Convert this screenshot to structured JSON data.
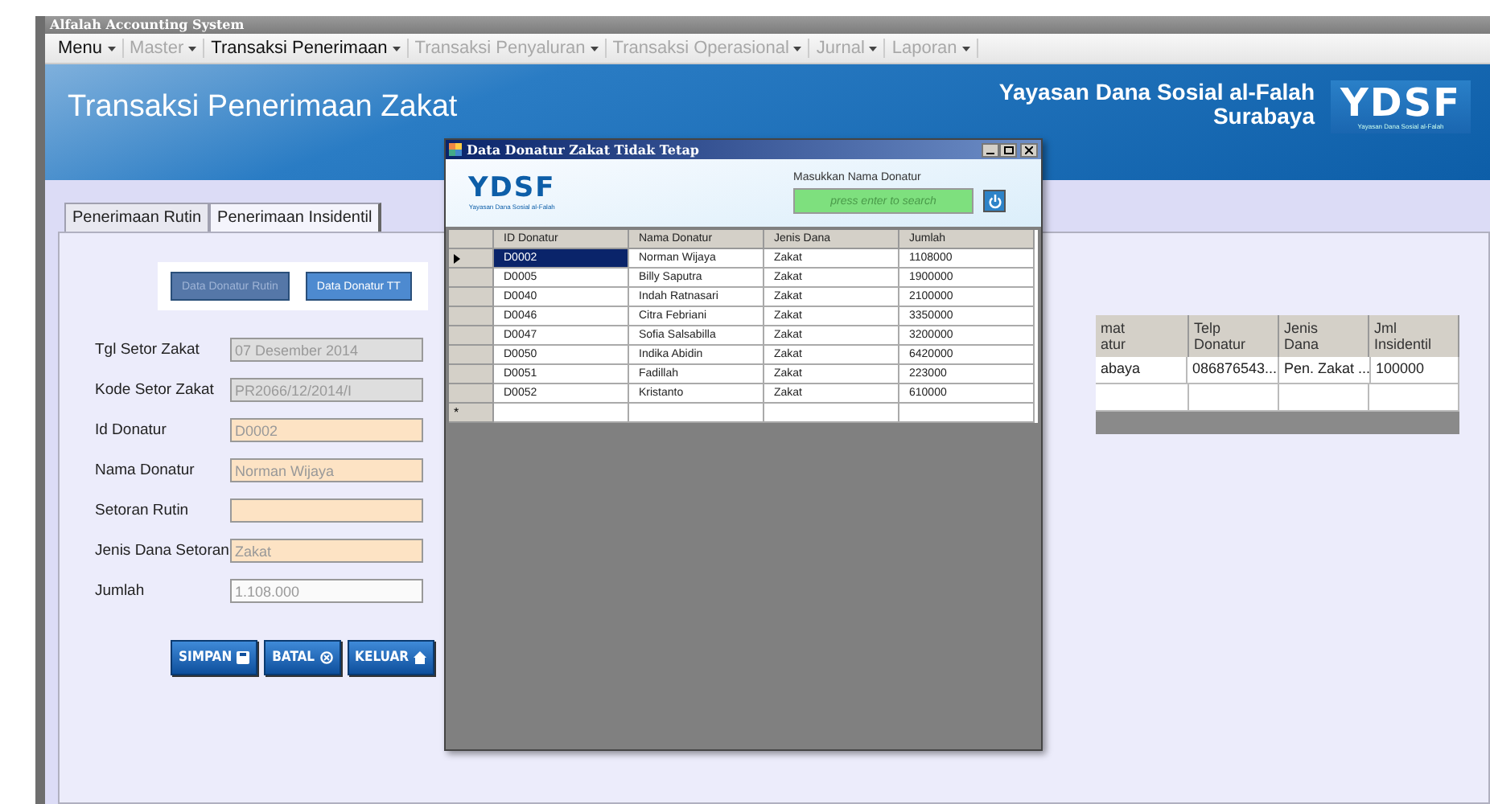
{
  "app_title": "Alfalah Accounting System",
  "menu": [
    {
      "label": "Menu",
      "disabled": false
    },
    {
      "label": "Master",
      "disabled": true
    },
    {
      "label": "Transaksi Penerimaan",
      "disabled": false
    },
    {
      "label": "Transaksi Penyaluran",
      "disabled": true
    },
    {
      "label": "Transaksi Operasional",
      "disabled": true
    },
    {
      "label": "Jurnal",
      "disabled": true
    },
    {
      "label": "Laporan",
      "disabled": true
    }
  ],
  "header": {
    "title": "Transaksi Penerimaan Zakat",
    "org_name": "Yayasan Dana Sosial al-Falah",
    "org_city": "Surabaya",
    "logo_text": "YDSF",
    "logo_tagline": "Yayasan Dana Sosial al-Falah"
  },
  "tabs": [
    {
      "label": "Penerimaan Rutin",
      "selected": false
    },
    {
      "label": "Penerimaan Insidentil",
      "selected": true
    }
  ],
  "source_buttons": [
    {
      "label": "Data Donatur Rutin",
      "disabled": true
    },
    {
      "label": "Data Donatur TT",
      "disabled": false
    }
  ],
  "form": [
    {
      "label": "Tgl Setor Zakat",
      "value": "07 Desember 2014",
      "kind": "readonly"
    },
    {
      "label": "Kode Setor Zakat",
      "value": "PR2066/12/2014/I",
      "kind": "readonly"
    },
    {
      "label": "Id Donatur",
      "value": "D0002",
      "kind": "filled"
    },
    {
      "label": "Nama Donatur",
      "value": "Norman Wijaya",
      "kind": "filled"
    },
    {
      "label": "Setoran Rutin",
      "kind": "filled"
    },
    {
      "label": "Jenis Dana Setoran",
      "value": "Zakat",
      "kind": "filled"
    },
    {
      "label": "Jumlah",
      "value": "1.108.000",
      "kind": "plain"
    }
  ],
  "action_buttons": [
    "SIMPAN",
    "BATAL",
    "KELUAR"
  ],
  "insidentil_table": {
    "columns": [
      "mat\natur",
      "Telp\nDonatur",
      "Jenis\nDana",
      "Jml\nInsidentil"
    ],
    "rows": [
      [
        "abaya",
        "086876543...",
        "Pen. Zakat ...",
        "100000"
      ]
    ]
  },
  "dialog": {
    "title": "Data Donatur Zakat Tidak Tetap",
    "logo_text": "YDSF",
    "logo_tagline": "Yayasan Dana Sosial al-Falah",
    "search_label": "Masukkan Nama Donatur",
    "search_placeholder": "press enter to search",
    "columns": [
      "ID Donatur",
      "Nama Donatur",
      "Jenis Dana",
      "Jumlah"
    ],
    "rows": [
      {
        "cells": [
          "D0002",
          "Norman Wijaya",
          "Zakat",
          "1108000"
        ],
        "selected": true
      },
      {
        "cells": [
          "D0005",
          "Billy Saputra",
          "Zakat",
          "1900000"
        ],
        "selected": false
      },
      {
        "cells": [
          "D0040",
          "Indah Ratnasari",
          "Zakat",
          "2100000"
        ],
        "selected": false
      },
      {
        "cells": [
          "D0046",
          "Citra Febriani",
          "Zakat",
          "3350000"
        ],
        "selected": false
      },
      {
        "cells": [
          "D0047",
          "Sofia Salsabilla",
          "Zakat",
          "3200000"
        ],
        "selected": false
      },
      {
        "cells": [
          "D0050",
          "Indika Abidin",
          "Zakat",
          "6420000"
        ],
        "selected": false
      },
      {
        "cells": [
          "D0051",
          "Fadillah",
          "Zakat",
          "223000"
        ],
        "selected": false
      },
      {
        "cells": [
          "D0052",
          "Kristanto",
          "Zakat",
          "610000"
        ],
        "selected": false
      }
    ],
    "new_row_marker": "*"
  }
}
